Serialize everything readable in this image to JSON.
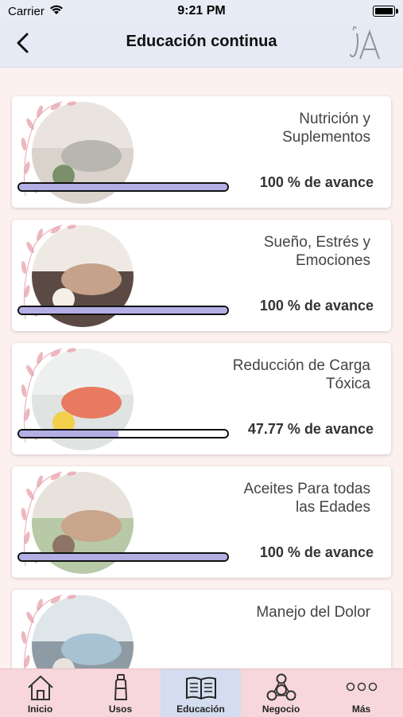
{
  "status_bar": {
    "carrier": "Carrier",
    "time": "9:21 PM"
  },
  "nav": {
    "title": "Educación continua",
    "back_icon": "chevron-left-icon",
    "logo_text": "LA"
  },
  "courses": [
    {
      "title": "Nutrición y\nSuplementos",
      "progress_label": "100 % de avance",
      "progress": 1.0
    },
    {
      "title": "Sueño, Estrés y\nEmociones",
      "progress_label": "100 % de avance",
      "progress": 1.0
    },
    {
      "title": "Reducción de Carga\nTóxica",
      "progress_label": "47.77 % de avance",
      "progress": 0.4777
    },
    {
      "title": "Aceites Para todas\nlas Edades",
      "progress_label": "100 % de avance",
      "progress": 1.0
    },
    {
      "title": "Manejo del Dolor",
      "progress_label": "",
      "progress": 0
    }
  ],
  "tabs": [
    {
      "label": "Inicio",
      "icon": "home-icon"
    },
    {
      "label": "Usos",
      "icon": "bottle-icon"
    },
    {
      "label": "Educación",
      "icon": "book-icon",
      "active": true
    },
    {
      "label": "Negocio",
      "icon": "network-icon"
    },
    {
      "label": "Más",
      "icon": "more-icon"
    }
  ],
  "colors": {
    "progress_fill": "#b3aee4",
    "tab_bar": "#f7d7dc",
    "active_tab": "#d3ddef",
    "nav_bar": "#e6eaf4"
  }
}
